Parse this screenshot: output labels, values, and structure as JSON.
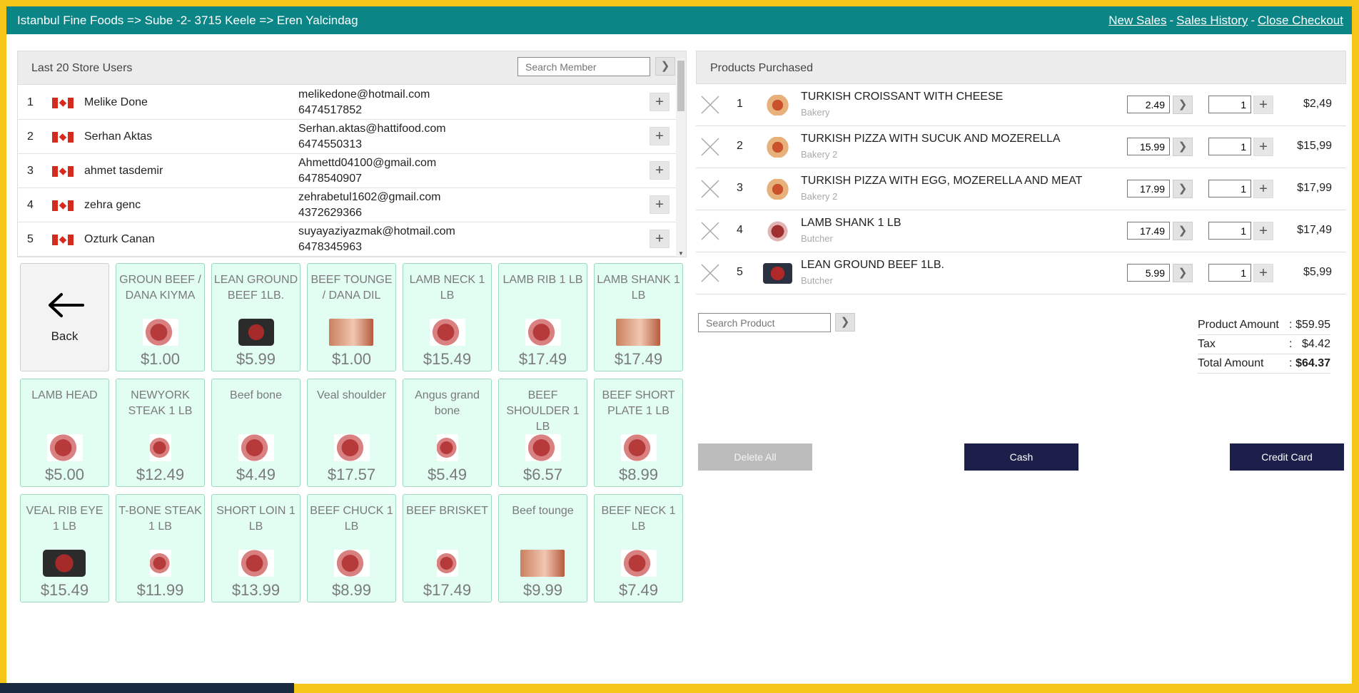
{
  "header": {
    "title": "Istanbul Fine Foods => Sube -2- 3715 Keele => Eren Yalcindag",
    "nav": [
      {
        "label": "New Sales"
      },
      {
        "label": "Sales History"
      },
      {
        "label": "Close Checkout"
      }
    ],
    "separator": "-"
  },
  "users": {
    "title": "Last 20 Store Users",
    "search_placeholder": "Search Member",
    "go_icon": "chevron-right-icon",
    "go_glyph": "❯",
    "add_glyph": "+",
    "rows": [
      {
        "num": "1",
        "name": "Melike Done",
        "email": "melikedone@hotmail.com",
        "phone": "6474517852"
      },
      {
        "num": "2",
        "name": "Serhan Aktas",
        "email": "Serhan.aktas@hattifood.com",
        "phone": "6474550313"
      },
      {
        "num": "3",
        "name": "ahmet tasdemir",
        "email": "Ahmettd04100@gmail.com",
        "phone": "6478540907"
      },
      {
        "num": "4",
        "name": "zehra genc",
        "email": "zehrabetul1602@gmail.com",
        "phone": "4372629366"
      },
      {
        "num": "5",
        "name": "Ozturk Canan",
        "email": "suyayaziyazmak@hotmail.com",
        "phone": "6478345963"
      }
    ]
  },
  "grid": {
    "back_label": "Back",
    "tiles": [
      {
        "name": "GROUN BEEF / DANA KIYMA",
        "price": "$1.00"
      },
      {
        "name": "LEAN GROUND BEEF 1LB.",
        "price": "$5.99"
      },
      {
        "name": "BEEF TOUNGE / DANA DIL",
        "price": "$1.00"
      },
      {
        "name": "LAMB NECK 1 LB",
        "price": "$15.49"
      },
      {
        "name": "LAMB RIB 1 LB",
        "price": "$17.49"
      },
      {
        "name": "LAMB SHANK 1 LB",
        "price": "$17.49"
      },
      {
        "name": "LAMB HEAD",
        "price": "$5.00"
      },
      {
        "name": "NEWYORK STEAK 1 LB",
        "price": "$12.49"
      },
      {
        "name": "Beef bone",
        "price": "$4.49"
      },
      {
        "name": "Veal shoulder",
        "price": "$17.57"
      },
      {
        "name": "Angus grand bone",
        "price": "$5.49"
      },
      {
        "name": "BEEF SHOULDER 1 LB",
        "price": "$6.57"
      },
      {
        "name": "BEEF SHORT PLATE 1 LB",
        "price": "$8.99"
      },
      {
        "name": "VEAL RIB EYE 1 LB",
        "price": "$15.49"
      },
      {
        "name": "T-BONE STEAK 1 LB",
        "price": "$11.99"
      },
      {
        "name": "SHORT LOIN 1 LB",
        "price": "$13.99"
      },
      {
        "name": "BEEF CHUCK 1 LB",
        "price": "$8.99"
      },
      {
        "name": "BEEF BRISKET",
        "price": "$17.49"
      },
      {
        "name": "Beef tounge",
        "price": "$9.99"
      },
      {
        "name": "BEEF NECK 1 LB",
        "price": "$7.49"
      }
    ]
  },
  "cart": {
    "title": "Products Purchased",
    "items": [
      {
        "num": "1",
        "name": "TURKISH CROISSANT WITH CHEESE",
        "category": "Bakery",
        "price": "2.49",
        "qty": "1",
        "total": "$2,49"
      },
      {
        "num": "2",
        "name": "TURKISH PIZZA WITH SUCUK AND MOZERELLA",
        "category": "Bakery 2",
        "price": "15.99",
        "qty": "1",
        "total": "$15,99"
      },
      {
        "num": "3",
        "name": "TURKISH PIZZA WITH EGG, MOZERELLA AND MEAT",
        "category": "Bakery 2",
        "price": "17.99",
        "qty": "1",
        "total": "$17,99"
      },
      {
        "num": "4",
        "name": "LAMB SHANK 1 LB",
        "category": "Butcher",
        "price": "17.49",
        "qty": "1",
        "total": "$17,49"
      },
      {
        "num": "5",
        "name": "LEAN GROUND BEEF 1LB.",
        "category": "Butcher",
        "price": "5.99",
        "qty": "1",
        "total": "$5,99"
      }
    ],
    "search_placeholder": "Search Product",
    "summary": {
      "product_amount_label": "Product Amount",
      "product_amount": "$59.95",
      "tax_label": "Tax",
      "tax": "$4.42",
      "total_label": "Total Amount",
      "total": "$64.37",
      "colon": ":"
    },
    "buttons": {
      "delete_all": "Delete All",
      "cash": "Cash",
      "credit_card": "Credit Card"
    }
  },
  "colors": {
    "frame": "#f5c518",
    "topbar": "#0b8585",
    "tile_bg": "#e2fdf2",
    "primary_button": "#1c1f4a"
  }
}
